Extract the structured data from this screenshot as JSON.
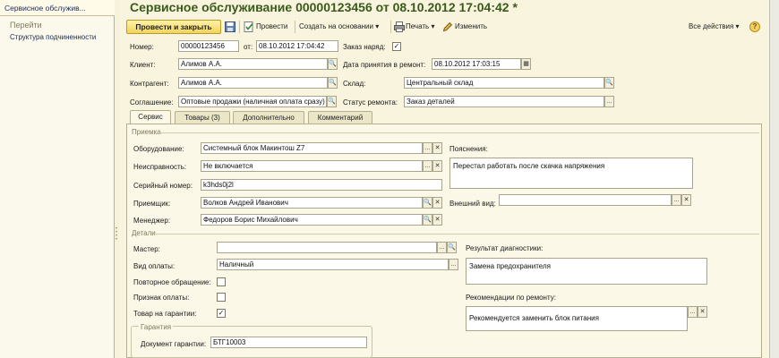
{
  "nav": {
    "tab_label": "Сервисное обслужив...",
    "section_title": "Перейти",
    "link_label": "Структура подчиненности"
  },
  "window": {
    "title": "Сервисное обслуживание 00000123456 от 08.10.2012 17:04:42 *"
  },
  "toolbar": {
    "post_close_label": "Провести и закрыть",
    "post_label": "Провести",
    "create_based_label": "Создать на основании",
    "print_label": "Печать",
    "edit_label": "Изменить",
    "all_actions_label": "Все действия",
    "help_label": "?"
  },
  "header": {
    "number_label": "Номер:",
    "number_value": "00000123456",
    "from_label": "от:",
    "date_value": "08.10.2012 17:04:42",
    "work_order_label": "Заказ наряд:",
    "work_order_checked": true,
    "client_label": "Клиент:",
    "client_value": "Алимов А.А.",
    "accept_date_label": "Дата принятия в ремонт:",
    "accept_date_value": "08.10.2012 17:03:15",
    "counterparty_label": "Контрагент:",
    "counterparty_value": "Алимов А.А.",
    "warehouse_label": "Склад:",
    "warehouse_value": "Центральный склад",
    "agreement_label": "Соглашение:",
    "agreement_value": "Оптовые продажи (наличная оплата сразу)",
    "repair_status_label": "Статус ремонта:",
    "repair_status_value": "Заказ деталей"
  },
  "tabs": [
    {
      "label": "Сервис",
      "active": true
    },
    {
      "label": "Товары (3)",
      "active": false
    },
    {
      "label": "Дополнительно",
      "active": false
    },
    {
      "label": "Комментарий",
      "active": false
    }
  ],
  "reception": {
    "title": "Приемка",
    "equipment_label": "Оборудование:",
    "equipment_value": "Системный блок Макинтош Z7",
    "fault_label": "Неисправность:",
    "fault_value": "Не включается",
    "serial_label": "Серийный номер:",
    "serial_value": "k3hds0j2l",
    "receiver_label": "Приемщик:",
    "receiver_value": "Волков Андрей Иванович",
    "manager_label": "Менеджер:",
    "manager_value": "Федоров Борис Михайлович",
    "explanations_label": "Пояснения:",
    "explanations_value": "Перестал работать после скачка напряжения",
    "appearance_label": "Внешний вид:",
    "appearance_value": ""
  },
  "details": {
    "title": "Детали",
    "master_label": "Мастер:",
    "master_value": "",
    "payment_type_label": "Вид оплаты:",
    "payment_type_value": "Наличный",
    "repeat_label": "Повторное обращение:",
    "repeat_checked": false,
    "paid_label": "Признак оплаты:",
    "paid_checked": false,
    "warranty_label": "Товар на гарантии:",
    "warranty_checked": true,
    "diagnostics_label": "Результат диагностики:",
    "diagnostics_value": "Замена предохранителя",
    "recommendations_label": "Рекомендации по ремонту:",
    "recommendations_value": "Рекомендуется заменить блок питания"
  },
  "warranty": {
    "title": "Гарантия",
    "doc_label": "Документ гарантии:",
    "doc_value": "БТГ10003"
  },
  "glyphs": {
    "search": "🔍",
    "ellipsis": "...",
    "clear": "✕",
    "check": "✓",
    "dropdown": "▾",
    "calendar": "▦"
  },
  "colors": {
    "title": "#3a5a1c",
    "accent_button": "#f2d45c",
    "panel_bg": "#fbf8e8"
  }
}
